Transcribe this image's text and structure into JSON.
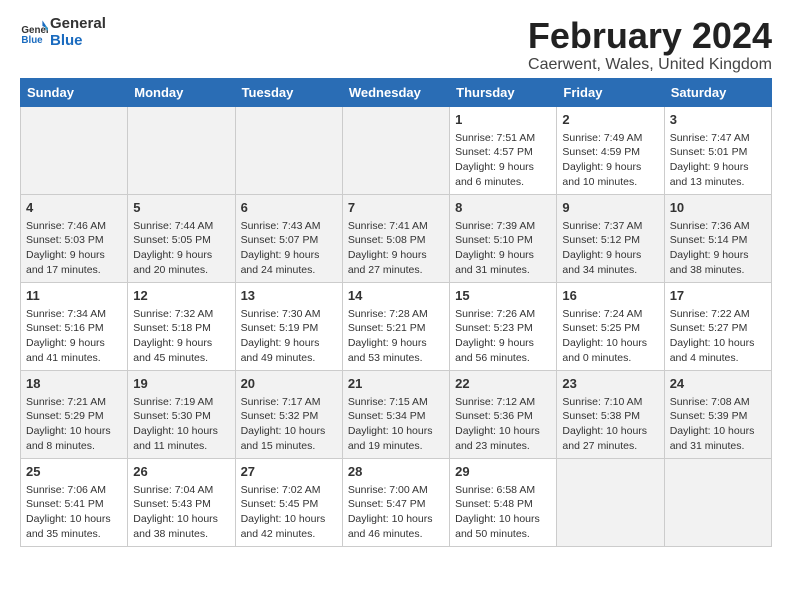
{
  "logo": {
    "line1": "General",
    "line2": "Blue"
  },
  "title": "February 2024",
  "subtitle": "Caerwent, Wales, United Kingdom",
  "weekdays": [
    "Sunday",
    "Monday",
    "Tuesday",
    "Wednesday",
    "Thursday",
    "Friday",
    "Saturday"
  ],
  "weeks": [
    [
      {
        "day": "",
        "content": ""
      },
      {
        "day": "",
        "content": ""
      },
      {
        "day": "",
        "content": ""
      },
      {
        "day": "",
        "content": ""
      },
      {
        "day": "1",
        "content": "Sunrise: 7:51 AM\nSunset: 4:57 PM\nDaylight: 9 hours\nand 6 minutes."
      },
      {
        "day": "2",
        "content": "Sunrise: 7:49 AM\nSunset: 4:59 PM\nDaylight: 9 hours\nand 10 minutes."
      },
      {
        "day": "3",
        "content": "Sunrise: 7:47 AM\nSunset: 5:01 PM\nDaylight: 9 hours\nand 13 minutes."
      }
    ],
    [
      {
        "day": "4",
        "content": "Sunrise: 7:46 AM\nSunset: 5:03 PM\nDaylight: 9 hours\nand 17 minutes."
      },
      {
        "day": "5",
        "content": "Sunrise: 7:44 AM\nSunset: 5:05 PM\nDaylight: 9 hours\nand 20 minutes."
      },
      {
        "day": "6",
        "content": "Sunrise: 7:43 AM\nSunset: 5:07 PM\nDaylight: 9 hours\nand 24 minutes."
      },
      {
        "day": "7",
        "content": "Sunrise: 7:41 AM\nSunset: 5:08 PM\nDaylight: 9 hours\nand 27 minutes."
      },
      {
        "day": "8",
        "content": "Sunrise: 7:39 AM\nSunset: 5:10 PM\nDaylight: 9 hours\nand 31 minutes."
      },
      {
        "day": "9",
        "content": "Sunrise: 7:37 AM\nSunset: 5:12 PM\nDaylight: 9 hours\nand 34 minutes."
      },
      {
        "day": "10",
        "content": "Sunrise: 7:36 AM\nSunset: 5:14 PM\nDaylight: 9 hours\nand 38 minutes."
      }
    ],
    [
      {
        "day": "11",
        "content": "Sunrise: 7:34 AM\nSunset: 5:16 PM\nDaylight: 9 hours\nand 41 minutes."
      },
      {
        "day": "12",
        "content": "Sunrise: 7:32 AM\nSunset: 5:18 PM\nDaylight: 9 hours\nand 45 minutes."
      },
      {
        "day": "13",
        "content": "Sunrise: 7:30 AM\nSunset: 5:19 PM\nDaylight: 9 hours\nand 49 minutes."
      },
      {
        "day": "14",
        "content": "Sunrise: 7:28 AM\nSunset: 5:21 PM\nDaylight: 9 hours\nand 53 minutes."
      },
      {
        "day": "15",
        "content": "Sunrise: 7:26 AM\nSunset: 5:23 PM\nDaylight: 9 hours\nand 56 minutes."
      },
      {
        "day": "16",
        "content": "Sunrise: 7:24 AM\nSunset: 5:25 PM\nDaylight: 10 hours\nand 0 minutes."
      },
      {
        "day": "17",
        "content": "Sunrise: 7:22 AM\nSunset: 5:27 PM\nDaylight: 10 hours\nand 4 minutes."
      }
    ],
    [
      {
        "day": "18",
        "content": "Sunrise: 7:21 AM\nSunset: 5:29 PM\nDaylight: 10 hours\nand 8 minutes."
      },
      {
        "day": "19",
        "content": "Sunrise: 7:19 AM\nSunset: 5:30 PM\nDaylight: 10 hours\nand 11 minutes."
      },
      {
        "day": "20",
        "content": "Sunrise: 7:17 AM\nSunset: 5:32 PM\nDaylight: 10 hours\nand 15 minutes."
      },
      {
        "day": "21",
        "content": "Sunrise: 7:15 AM\nSunset: 5:34 PM\nDaylight: 10 hours\nand 19 minutes."
      },
      {
        "day": "22",
        "content": "Sunrise: 7:12 AM\nSunset: 5:36 PM\nDaylight: 10 hours\nand 23 minutes."
      },
      {
        "day": "23",
        "content": "Sunrise: 7:10 AM\nSunset: 5:38 PM\nDaylight: 10 hours\nand 27 minutes."
      },
      {
        "day": "24",
        "content": "Sunrise: 7:08 AM\nSunset: 5:39 PM\nDaylight: 10 hours\nand 31 minutes."
      }
    ],
    [
      {
        "day": "25",
        "content": "Sunrise: 7:06 AM\nSunset: 5:41 PM\nDaylight: 10 hours\nand 35 minutes."
      },
      {
        "day": "26",
        "content": "Sunrise: 7:04 AM\nSunset: 5:43 PM\nDaylight: 10 hours\nand 38 minutes."
      },
      {
        "day": "27",
        "content": "Sunrise: 7:02 AM\nSunset: 5:45 PM\nDaylight: 10 hours\nand 42 minutes."
      },
      {
        "day": "28",
        "content": "Sunrise: 7:00 AM\nSunset: 5:47 PM\nDaylight: 10 hours\nand 46 minutes."
      },
      {
        "day": "29",
        "content": "Sunrise: 6:58 AM\nSunset: 5:48 PM\nDaylight: 10 hours\nand 50 minutes."
      },
      {
        "day": "",
        "content": ""
      },
      {
        "day": "",
        "content": ""
      }
    ]
  ]
}
